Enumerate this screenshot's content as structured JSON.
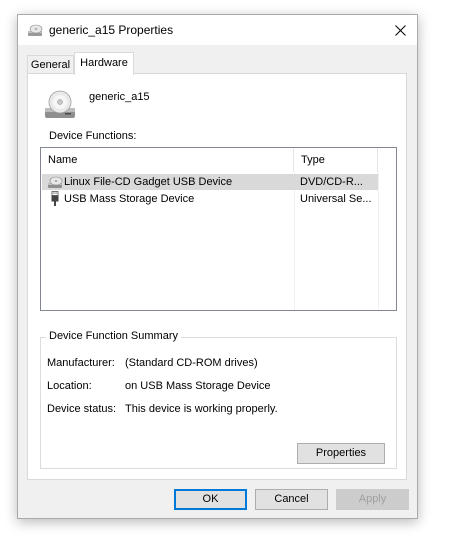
{
  "window": {
    "title": "generic_a15 Properties",
    "close_symbol": "✕"
  },
  "tabs": [
    {
      "label": "General",
      "active": false
    },
    {
      "label": "Hardware",
      "active": true
    }
  ],
  "device": {
    "name": "generic_a15",
    "icon": "cd-drive-icon"
  },
  "device_functions": {
    "label": "Device Functions:",
    "columns": [
      "Name",
      "Type"
    ],
    "rows": [
      {
        "name": "Linux File-CD Gadget USB Device",
        "type": "DVD/CD-R...",
        "icon": "cd-drive-icon",
        "selected": true
      },
      {
        "name": "USB Mass Storage Device",
        "type": "Universal Se...",
        "icon": "usb-icon",
        "selected": false
      }
    ]
  },
  "summary": {
    "title": "Device Function Summary",
    "manufacturer_label": "Manufacturer:",
    "manufacturer_value": "(Standard CD-ROM drives)",
    "location_label": "Location:",
    "location_value": "on USB Mass Storage Device",
    "status_label": "Device status:",
    "status_value": "This device is working properly.",
    "properties_button": "Properties"
  },
  "buttons": {
    "ok": "OK",
    "cancel": "Cancel",
    "apply": "Apply"
  },
  "colors": {
    "selection": "#d9d9d9",
    "default_button_border": "#0078d7",
    "disabled_text": "#a0a0a0"
  }
}
